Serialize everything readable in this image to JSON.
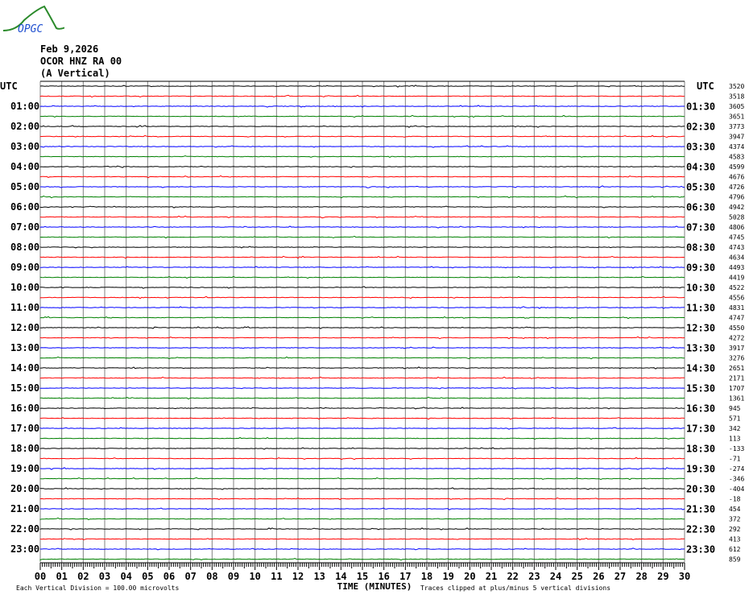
{
  "logo": {
    "text": "OPGC"
  },
  "header": {
    "date": "Feb 9,2026",
    "station": "OCOR HNZ RA 00",
    "component": "(A Vertical)"
  },
  "chart_data": {
    "type": "line",
    "left_axis_title": "UTC",
    "right_axis_title": "UTC",
    "left_labels": [
      "01:00",
      "02:00",
      "03:00",
      "04:00",
      "05:00",
      "06:00",
      "07:00",
      "08:00",
      "09:00",
      "10:00",
      "11:00",
      "12:00",
      "13:00",
      "14:00",
      "15:00",
      "16:00",
      "17:00",
      "18:00",
      "19:00",
      "20:00",
      "21:00",
      "22:00",
      "23:00"
    ],
    "right_labels": [
      "01:30",
      "02:30",
      "03:30",
      "04:30",
      "05:30",
      "06:30",
      "07:30",
      "08:30",
      "09:30",
      "10:30",
      "11:30",
      "12:30",
      "13:30",
      "14:30",
      "15:30",
      "16:30",
      "17:30",
      "18:30",
      "19:30",
      "20:30",
      "21:30",
      "22:30",
      "23:30"
    ],
    "offsets": [
      "3520",
      "3518",
      "3605",
      "3651",
      "3773",
      "3947",
      "4374",
      "4583",
      "4599",
      "4676",
      "4726",
      "4796",
      "4942",
      "5028",
      "4806",
      "4745",
      "4743",
      "4634",
      "4493",
      "4419",
      "4522",
      "4556",
      "4831",
      "4747",
      "4550",
      "4272",
      "3917",
      "3276",
      "2651",
      "2171",
      "1707",
      "1361",
      "945",
      "571",
      "342",
      "113",
      "-133",
      "-71",
      "-274",
      "-346",
      "-404",
      "-18",
      "454",
      "372",
      "292",
      "413",
      "612",
      "859"
    ],
    "trace_colors": [
      "#000000",
      "#ff0000",
      "#0000ff",
      "#008000"
    ],
    "x_ticks": [
      "00",
      "01",
      "02",
      "03",
      "04",
      "05",
      "06",
      "07",
      "08",
      "09",
      "10",
      "11",
      "12",
      "13",
      "14",
      "15",
      "16",
      "17",
      "18",
      "19",
      "20",
      "21",
      "22",
      "23",
      "24",
      "25",
      "26",
      "27",
      "28",
      "29",
      "30"
    ],
    "xlim": [
      0,
      30
    ],
    "xlabel": "TIME (MINUTES)",
    "traces_per_hour": 2,
    "hours": 24
  },
  "footer": {
    "scale": "Each Vertical Division =  100.00 microvolts",
    "clip": "Traces clipped at plus/minus 5 vertical divisions"
  }
}
